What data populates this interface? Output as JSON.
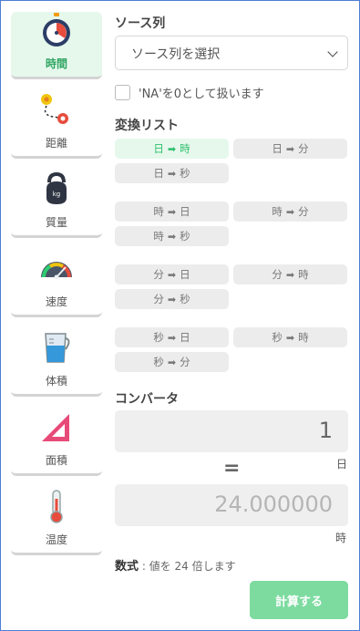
{
  "sidebar": {
    "items": [
      {
        "label": "時間",
        "icon": "stopwatch-icon"
      },
      {
        "label": "距離",
        "icon": "map-route-icon"
      },
      {
        "label": "質量",
        "icon": "kettlebell-icon"
      },
      {
        "label": "速度",
        "icon": "speedometer-icon"
      },
      {
        "label": "体積",
        "icon": "measuring-cup-icon"
      },
      {
        "label": "面積",
        "icon": "triangle-ruler-icon"
      },
      {
        "label": "温度",
        "icon": "thermometer-icon"
      }
    ]
  },
  "source": {
    "heading": "ソース列",
    "select_value": "ソース列を選択",
    "na_label": "'NA'を0として扱います"
  },
  "conversions": {
    "heading": "変換リスト",
    "arrow": "➡",
    "groups": [
      [
        {
          "from": "日",
          "to": "時"
        },
        {
          "from": "日",
          "to": "分"
        },
        {
          "from": "日",
          "to": "秒"
        }
      ],
      [
        {
          "from": "時",
          "to": "日"
        },
        {
          "from": "時",
          "to": "分"
        },
        {
          "from": "時",
          "to": "秒"
        }
      ],
      [
        {
          "from": "分",
          "to": "日"
        },
        {
          "from": "分",
          "to": "時"
        },
        {
          "from": "分",
          "to": "秒"
        }
      ],
      [
        {
          "from": "秒",
          "to": "日"
        },
        {
          "from": "秒",
          "to": "時"
        },
        {
          "from": "秒",
          "to": "分"
        }
      ]
    ]
  },
  "converter": {
    "heading": "コンバータ",
    "input_value": "1",
    "input_unit": "日",
    "equals": "=",
    "output_value": "24.000000",
    "output_unit": "時",
    "formula_label": "数式",
    "formula_text": " : 値を 24 倍します",
    "calc_label": "計算する"
  },
  "colors": {
    "accent_green": "#2fbf6d",
    "active_bg": "#e6f8ec",
    "button_green": "#7ddba0",
    "frame_border": "#4d7fd6"
  }
}
